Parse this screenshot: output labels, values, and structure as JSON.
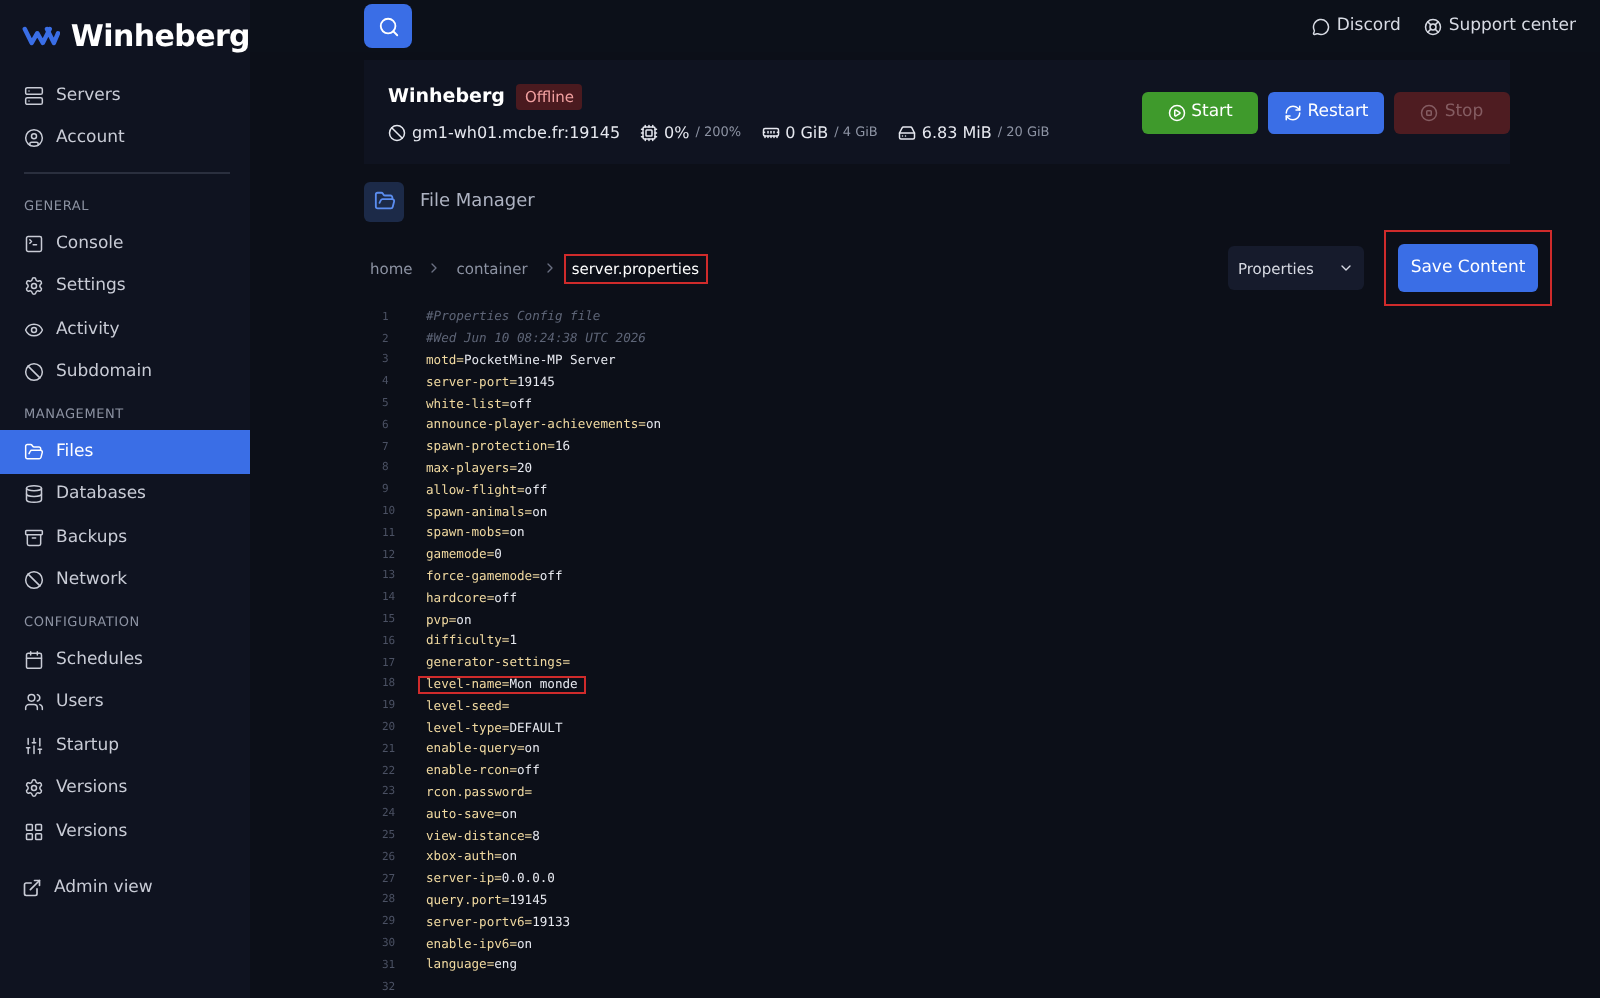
{
  "brand": {
    "name": "Winheberg"
  },
  "sidebar": {
    "top": [
      {
        "label": "Servers",
        "kind": "server",
        "selected": false
      },
      {
        "label": "Account",
        "kind": "account",
        "selected": false
      }
    ],
    "groups": [
      {
        "title": "GENERAL",
        "items": [
          {
            "label": "Console",
            "kind": "terminal",
            "selected": false
          },
          {
            "label": "Settings",
            "kind": "gear",
            "selected": false
          },
          {
            "label": "Activity",
            "kind": "eye",
            "selected": false
          },
          {
            "label": "Subdomain",
            "kind": "globe",
            "selected": false
          }
        ]
      },
      {
        "title": "MANAGEMENT",
        "items": [
          {
            "label": "Files",
            "kind": "folder",
            "selected": true
          },
          {
            "label": "Databases",
            "kind": "database",
            "selected": false
          },
          {
            "label": "Backups",
            "kind": "archive",
            "selected": false
          },
          {
            "label": "Network",
            "kind": "globe",
            "selected": false
          }
        ]
      },
      {
        "title": "CONFIGURATION",
        "items": [
          {
            "label": "Schedules",
            "kind": "calendar",
            "selected": false
          },
          {
            "label": "Users",
            "kind": "users",
            "selected": false
          },
          {
            "label": "Startup",
            "kind": "sliders",
            "selected": false
          },
          {
            "label": "Versions",
            "kind": "gear",
            "selected": false
          },
          {
            "label": "Versions",
            "kind": "grid",
            "selected": false
          }
        ]
      }
    ],
    "footer": {
      "label": "Admin view"
    }
  },
  "topbar": {
    "links": [
      {
        "label": "Discord",
        "kind": "discord"
      },
      {
        "label": "Support center",
        "kind": "support"
      }
    ]
  },
  "server": {
    "name": "Winheberg",
    "status": "Offline",
    "stats": [
      {
        "kind": "address",
        "value": "gm1-wh01.mcbe.fr:19145"
      },
      {
        "kind": "cpu",
        "value": "0%",
        "limit": "/ 200%"
      },
      {
        "kind": "memory",
        "value": "0 GiB",
        "limit": "/ 4 GiB"
      },
      {
        "kind": "disk",
        "value": "6.83 MiB",
        "limit": "/ 20 GiB"
      }
    ],
    "buttons": [
      {
        "label": "Start",
        "kind": "start",
        "disabled": false
      },
      {
        "label": "Restart",
        "kind": "restart",
        "disabled": false
      },
      {
        "label": "Stop",
        "kind": "stop",
        "disabled": true
      }
    ]
  },
  "file_manager": {
    "title": "File Manager",
    "breadcrumb": [
      {
        "label": "home",
        "highlighted": false
      },
      {
        "label": "container",
        "highlighted": false
      },
      {
        "label": "server.properties",
        "highlighted": true
      }
    ],
    "mode_select": {
      "value": "Properties"
    },
    "save_button": {
      "label": "Save Content",
      "highlighted": true
    },
    "lines": [
      {
        "number": "1",
        "kind": "comment",
        "text": "#Properties Config file",
        "highlighted": false
      },
      {
        "number": "2",
        "kind": "comment",
        "text": "#Wed Jun 10 08:24:38 UTC 2026",
        "highlighted": false
      },
      {
        "number": "3",
        "kind": "pair",
        "key": "motd=",
        "value": "PocketMine-MP Server",
        "highlighted": false
      },
      {
        "number": "4",
        "kind": "pair",
        "key": "server-port=",
        "value": "19145",
        "highlighted": false
      },
      {
        "number": "5",
        "kind": "pair",
        "key": "white-list=",
        "value": "off",
        "highlighted": false
      },
      {
        "number": "6",
        "kind": "pair",
        "key": "announce-player-achievements=",
        "value": "on",
        "highlighted": false
      },
      {
        "number": "7",
        "kind": "pair",
        "key": "spawn-protection=",
        "value": "16",
        "highlighted": false
      },
      {
        "number": "8",
        "kind": "pair",
        "key": "max-players=",
        "value": "20",
        "highlighted": false
      },
      {
        "number": "9",
        "kind": "pair",
        "key": "allow-flight=",
        "value": "off",
        "highlighted": false
      },
      {
        "number": "10",
        "kind": "pair",
        "key": "spawn-animals=",
        "value": "on",
        "highlighted": false
      },
      {
        "number": "11",
        "kind": "pair",
        "key": "spawn-mobs=",
        "value": "on",
        "highlighted": false
      },
      {
        "number": "12",
        "kind": "pair",
        "key": "gamemode=",
        "value": "0",
        "highlighted": false
      },
      {
        "number": "13",
        "kind": "pair",
        "key": "force-gamemode=",
        "value": "off",
        "highlighted": false
      },
      {
        "number": "14",
        "kind": "pair",
        "key": "hardcore=",
        "value": "off",
        "highlighted": false
      },
      {
        "number": "15",
        "kind": "pair",
        "key": "pvp=",
        "value": "on",
        "highlighted": false
      },
      {
        "number": "16",
        "kind": "pair",
        "key": "difficulty=",
        "value": "1",
        "highlighted": false
      },
      {
        "number": "17",
        "kind": "pair",
        "key": "generator-settings=",
        "highlighted": false
      },
      {
        "number": "18",
        "kind": "pair",
        "key": "level-name=",
        "value": "Mon monde",
        "highlighted": true
      },
      {
        "number": "19",
        "kind": "pair",
        "key": "level-seed=",
        "highlighted": false
      },
      {
        "number": "20",
        "kind": "pair",
        "key": "level-type=",
        "value": "DEFAULT",
        "highlighted": false
      },
      {
        "number": "21",
        "kind": "pair",
        "key": "enable-query=",
        "value": "on",
        "highlighted": false
      },
      {
        "number": "22",
        "kind": "pair",
        "key": "enable-rcon=",
        "value": "off",
        "highlighted": false
      },
      {
        "number": "23",
        "kind": "pair",
        "key": "rcon.password=",
        "highlighted": false
      },
      {
        "number": "24",
        "kind": "pair",
        "key": "auto-save=",
        "value": "on",
        "highlighted": false
      },
      {
        "number": "25",
        "kind": "pair",
        "key": "view-distance=",
        "value": "8",
        "highlighted": false
      },
      {
        "number": "26",
        "kind": "pair",
        "key": "xbox-auth=",
        "value": "on",
        "highlighted": false
      },
      {
        "number": "27",
        "kind": "pair",
        "key": "server-ip=",
        "value": "0.0.0.0",
        "highlighted": false
      },
      {
        "number": "28",
        "kind": "pair",
        "key": "query.port=",
        "value": "19145",
        "highlighted": false
      },
      {
        "number": "29",
        "kind": "pair",
        "key": "server-portv6=",
        "value": "19133",
        "highlighted": false
      },
      {
        "number": "30",
        "kind": "pair",
        "key": "enable-ipv6=",
        "value": "on",
        "highlighted": false
      },
      {
        "number": "31",
        "kind": "pair",
        "key": "language=",
        "value": "eng",
        "highlighted": false
      },
      {
        "number": "32",
        "kind": "empty"
      }
    ]
  }
}
